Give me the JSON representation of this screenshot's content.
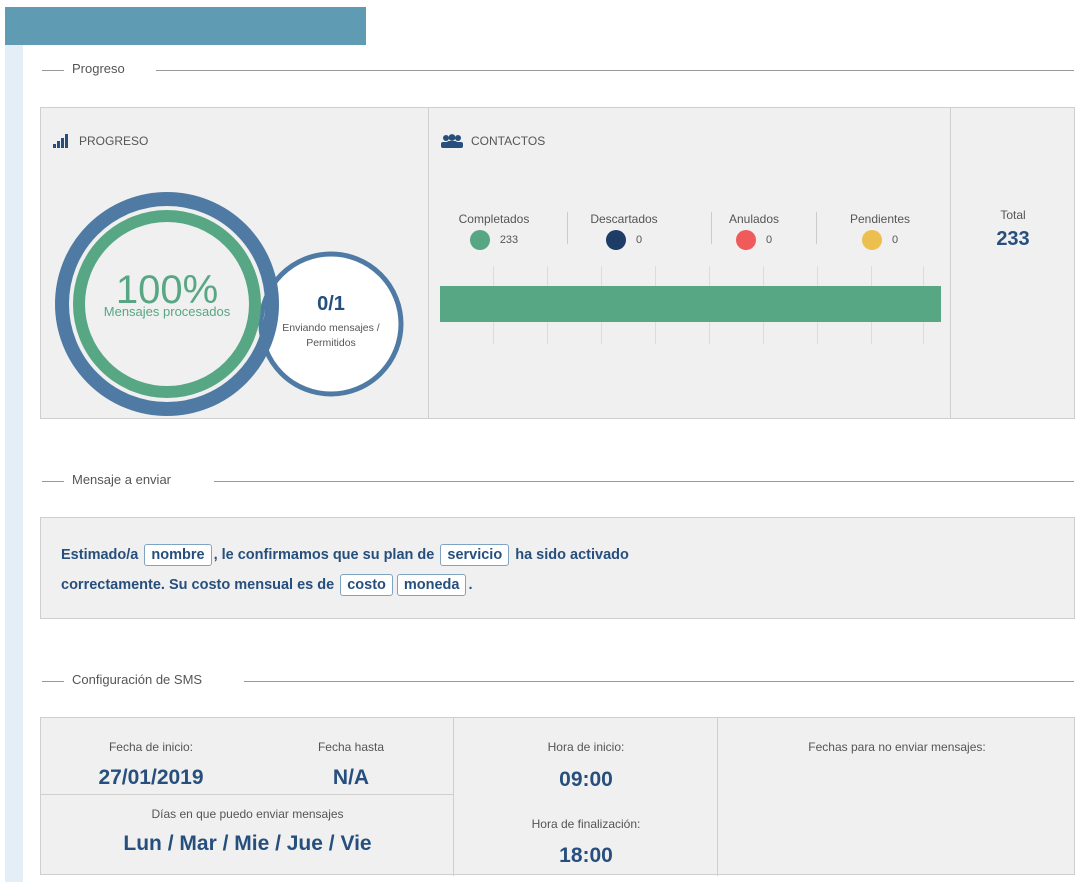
{
  "sections": {
    "progress_title": "Progreso",
    "message_title": "Mensaje a enviar",
    "sms_title": "Configuración de SMS"
  },
  "progress": {
    "header": "PROGRESO",
    "percent_text": "100%",
    "percent_caption": "Mensajes procesados",
    "percent_value": 1.0,
    "sending_value": "0/1",
    "sending_caption_line1": "Enviando mensajes /",
    "sending_caption_line2": "Permitidos"
  },
  "contacts": {
    "header": "CONTACTOS",
    "categories": [
      {
        "label": "Completados",
        "count": "233",
        "color": "#57a684"
      },
      {
        "label": "Descartados",
        "count": "0",
        "color": "#1e3d66"
      },
      {
        "label": "Anulados",
        "count": "0",
        "color": "#f05a5a"
      },
      {
        "label": "Pendientes",
        "count": "0",
        "color": "#ebc04f"
      }
    ],
    "completed_fraction": 1.0,
    "total_label": "Total",
    "total_value": "233"
  },
  "message": {
    "part1": "Estimado/a",
    "var1": "nombre",
    "part2": ", le confirmamos que su plan de",
    "var2": "servicio",
    "part3": "ha sido activado",
    "part4": "correctamente. Su costo mensual es de",
    "var3": "costo",
    "var4": "moneda",
    "part5": "."
  },
  "sms_config": {
    "start_date_label": "Fecha de inicio:",
    "start_date": "27/01/2019",
    "end_date_label": "Fecha hasta",
    "end_date": "N/A",
    "days_label": "Días en que puedo enviar mensajes",
    "days": "Lun / Mar / Mie / Jue / Vie",
    "start_time_label": "Hora de inicio:",
    "start_time": "09:00",
    "end_time_label": "Hora de finalización:",
    "end_time": "18:00",
    "blocked_dates_label": "Fechas para no enviar mensajes:"
  },
  "colors": {
    "accent": "#5f9bb2",
    "ring_outer": "#4e7aa3",
    "ring_inner": "#57a684",
    "value_text": "#274f7d"
  }
}
